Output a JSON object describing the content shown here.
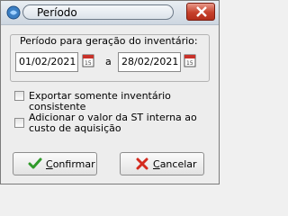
{
  "window": {
    "title": "Período"
  },
  "group": {
    "label": "Período para geração do inventário:",
    "start_date": "01/02/2021",
    "separator": "a",
    "end_date": "28/02/2021"
  },
  "options": [
    {
      "label": "Exportar somente inventário consistente",
      "checked": false
    },
    {
      "label": "Adicionar o valor da ST interna ao custo de aquisição",
      "checked": false
    }
  ],
  "buttons": {
    "confirm_rest": "onfirmar",
    "confirm_hotkey": "C",
    "cancel_rest": "ancelar",
    "cancel_hotkey": "C"
  },
  "colors": {
    "close_red": "#c6402b",
    "confirm_green": "#2f9a2a",
    "cancel_red": "#d42a1e"
  }
}
